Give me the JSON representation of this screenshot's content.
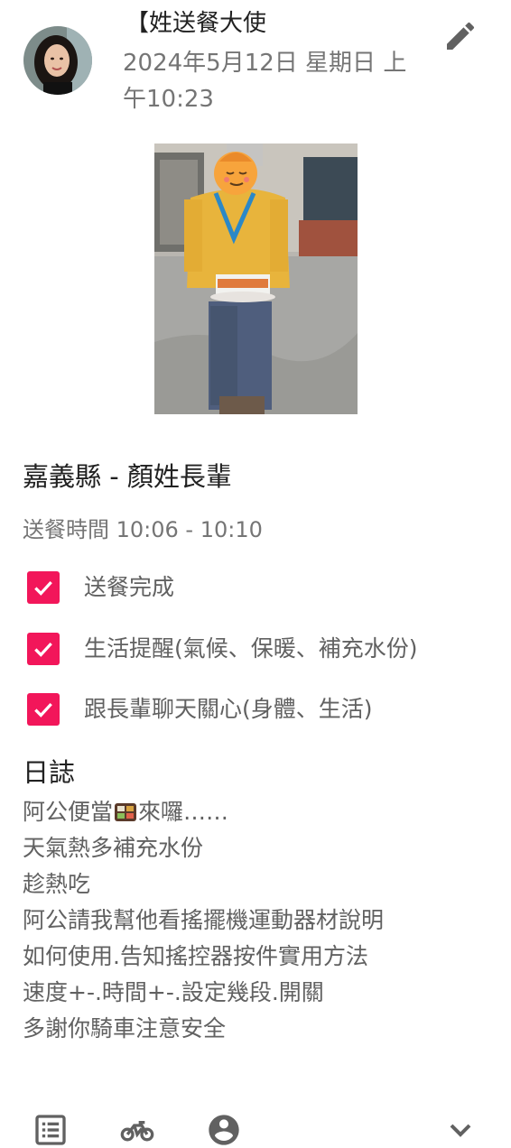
{
  "header": {
    "author": "【姓送餐大使",
    "datetime": "2024年5月12日 星期日 上午10:23",
    "edit_icon": "pencil-icon"
  },
  "post": {
    "place": "嘉義縣 - 顏姓長輩",
    "delivery_time": "送餐時間 10:06 - 10:10",
    "checklist": [
      {
        "label": "送餐完成",
        "checked": true
      },
      {
        "label": "生活提醒(氣候、保暖、補充水份)",
        "checked": true
      },
      {
        "label": "跟長輩聊天關心(身體、生活)",
        "checked": true
      }
    ],
    "log_title": "日誌",
    "log_line1_a": "阿公便當",
    "log_line1_b": "來囉……",
    "log_lines": [
      "天氣熱多補充水份",
      "趁熱吃",
      "阿公請我幫他看搖擺機運動器材說明",
      "如何使用.告知搖控器按件實用方法",
      "速度+-.時間+-.設定幾段.開關",
      "多謝你騎車注意安全"
    ]
  },
  "bottom_nav": {
    "icons": [
      "list-icon",
      "motorcycle-icon",
      "account-icon",
      "chevron-down-icon"
    ]
  },
  "colors": {
    "accent": "#f2165a",
    "primary_text": "#212121",
    "secondary_text": "#757575",
    "icon": "#616161"
  }
}
